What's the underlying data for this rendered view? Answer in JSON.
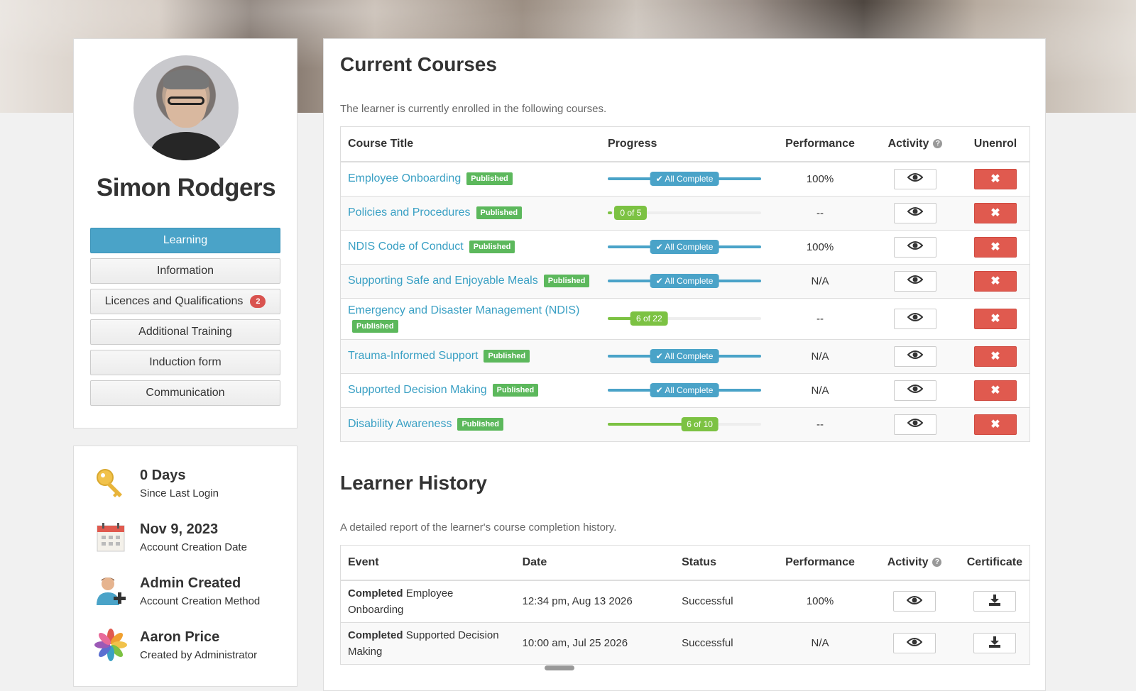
{
  "profile": {
    "name": "Simon Rodgers",
    "menu": [
      {
        "label": "Learning",
        "active": true
      },
      {
        "label": "Information"
      },
      {
        "label": "Licences and Qualifications",
        "badge": "2"
      },
      {
        "label": "Additional Training"
      },
      {
        "label": "Induction form"
      },
      {
        "label": "Communication"
      }
    ]
  },
  "stats": [
    {
      "icon": "key-icon",
      "value": "0 Days",
      "label": "Since Last Login"
    },
    {
      "icon": "calendar-icon",
      "value": "Nov 9, 2023",
      "label": "Account Creation Date"
    },
    {
      "icon": "user-add-icon",
      "value": "Admin Created",
      "label": "Account Creation Method"
    },
    {
      "icon": "pinwheel-icon",
      "value": "Aaron Price",
      "label": "Created by Administrator"
    }
  ],
  "current_courses": {
    "title": "Current Courses",
    "description": "The learner is currently enrolled in the following courses.",
    "columns": [
      "Course Title",
      "Progress",
      "Performance",
      "Activity",
      "Unenrol"
    ],
    "published_label": "Published",
    "rows": [
      {
        "title": "Employee Onboarding",
        "progress_label": "All Complete",
        "progress": 1.0,
        "complete": true,
        "performance": "100%"
      },
      {
        "title": "Policies and Procedures",
        "progress_label": "0 of 5",
        "progress": 0.0,
        "complete": false,
        "performance": "--"
      },
      {
        "title": "NDIS Code of Conduct",
        "progress_label": "All Complete",
        "progress": 1.0,
        "complete": true,
        "performance": "100%"
      },
      {
        "title": "Supporting Safe and Enjoyable Meals",
        "progress_label": "All Complete",
        "progress": 1.0,
        "complete": true,
        "performance": "N/A"
      },
      {
        "title": "Emergency and Disaster Management (NDIS)",
        "progress_label": "6 of 22",
        "progress": 0.27,
        "complete": false,
        "performance": "--"
      },
      {
        "title": "Trauma-Informed Support",
        "progress_label": "All Complete",
        "progress": 1.0,
        "complete": true,
        "performance": "N/A"
      },
      {
        "title": "Supported Decision Making",
        "progress_label": "All Complete",
        "progress": 1.0,
        "complete": true,
        "performance": "N/A"
      },
      {
        "title": "Disability Awareness",
        "progress_label": "6 of 10",
        "progress": 0.6,
        "complete": false,
        "performance": "--"
      }
    ]
  },
  "learner_history": {
    "title": "Learner History",
    "description": "A detailed report of the learner's course completion history.",
    "columns": [
      "Event",
      "Date",
      "Status",
      "Performance",
      "Activity",
      "Certificate"
    ],
    "rows": [
      {
        "event_verb": "Completed",
        "event_course": "Employee Onboarding",
        "date": "12:34 pm, Aug 13 2026",
        "status": "Successful",
        "performance": "100%"
      },
      {
        "event_verb": "Completed",
        "event_course": "Supported Decision Making",
        "date": "10:00 am, Jul 25 2026",
        "status": "Successful",
        "performance": "N/A"
      }
    ]
  },
  "colors": {
    "accent": "#4aa3c8",
    "published": "#5cb85c",
    "partial_progress": "#7cc243",
    "danger": "#e05a4f",
    "badge": "#d9534f"
  }
}
